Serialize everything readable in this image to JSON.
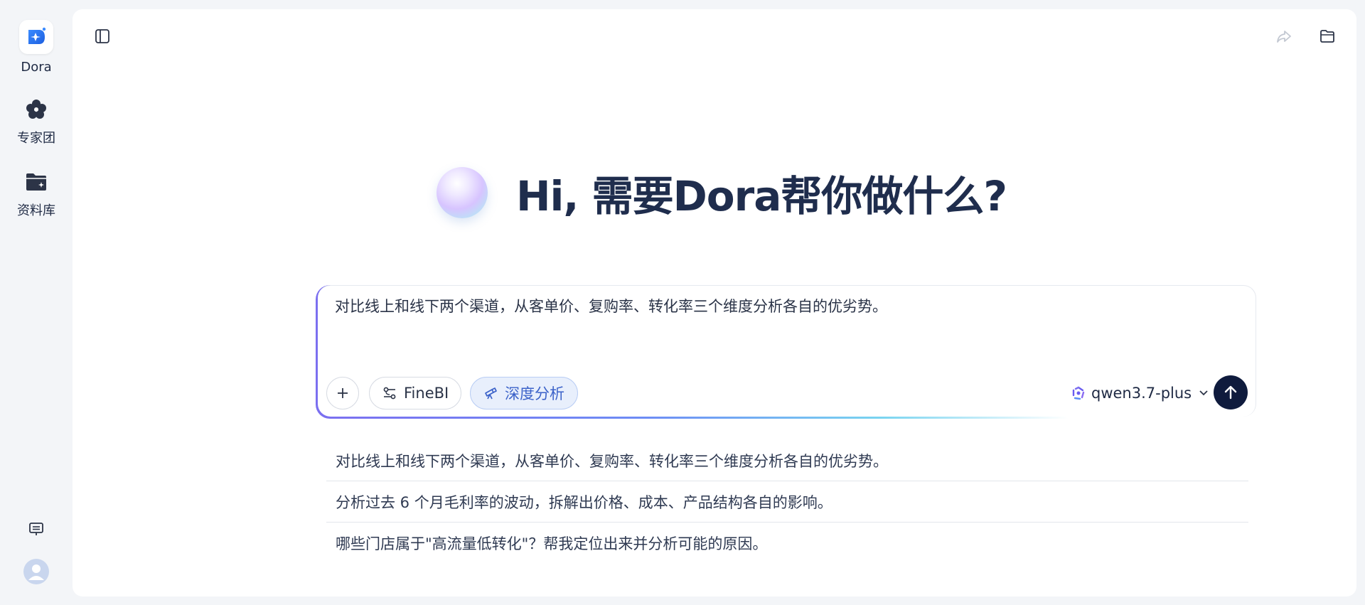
{
  "sidebar": {
    "items": [
      {
        "label": "Dora",
        "icon": "dora-logo-icon"
      },
      {
        "label": "专家团",
        "icon": "flower-icon"
      },
      {
        "label": "资料库",
        "icon": "folder-star-icon"
      }
    ],
    "bottom_icons": [
      "feedback-icon",
      "user-avatar-icon"
    ]
  },
  "header": {
    "icons": [
      "sidebar-toggle-icon",
      "share-icon",
      "folder-icon"
    ]
  },
  "hero": {
    "title": "Hi, 需要Dora帮你做什么?"
  },
  "composer": {
    "text": "对比线上和线下两个渠道，从客单价、复购率、转化率三个维度分析各自的优劣势。",
    "tools": [
      {
        "label": "FineBI",
        "icon": "data-source-icon",
        "active": false
      },
      {
        "label": "深度分析",
        "icon": "telescope-icon",
        "active": true
      }
    ],
    "model": "qwen3.7-plus"
  },
  "suggestions": [
    "对比线上和线下两个渠道，从客单价、复购率、转化率三个维度分析各自的优劣势。",
    "分析过去 6 个月毛利率的波动，拆解出价格、成本、产品结构各自的影响。",
    "哪些门店属于\"高流量低转化\"？帮我定位出来并分析可能的原因。"
  ],
  "colors": {
    "accent": "#3b62c9",
    "send_button": "#0f1b3d",
    "title": "#1f2d4d"
  }
}
